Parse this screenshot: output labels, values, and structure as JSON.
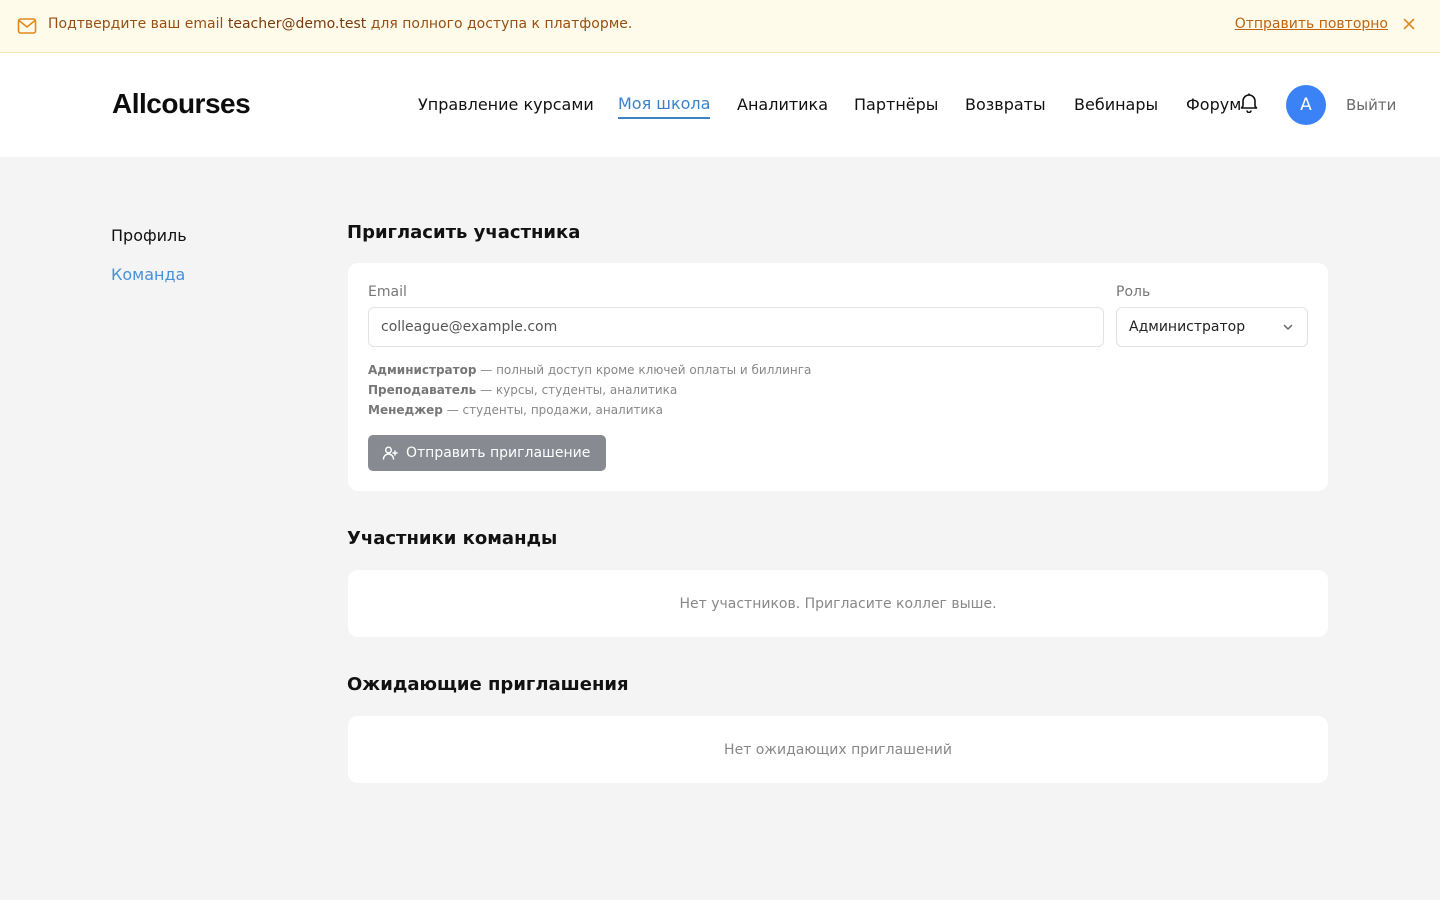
{
  "banner": {
    "message_prefix": "Подтвердите ваш email",
    "email": "teacher@demo.test",
    "message_suffix": "для полного доступа к платформе.",
    "resend_label": "Отправить повторно"
  },
  "header": {
    "logo": "Allcourses",
    "nav": [
      {
        "label": "Управление курсами",
        "active": false
      },
      {
        "label": "Моя школа",
        "active": true
      },
      {
        "label": "Аналитика",
        "active": false
      },
      {
        "label": "Партнёры",
        "active": false
      },
      {
        "label": "Возвраты",
        "active": false
      },
      {
        "label": "Вебинары",
        "active": false
      },
      {
        "label": "Форум",
        "active": false
      }
    ],
    "avatar_letter": "A",
    "logout_label": "Выйти"
  },
  "sidebar": {
    "items": [
      {
        "label": "Профиль",
        "active": false
      },
      {
        "label": "Команда",
        "active": true
      }
    ]
  },
  "invite": {
    "title": "Пригласить участника",
    "email_label": "Email",
    "email_placeholder": "colleague@example.com",
    "role_label": "Роль",
    "role_value": "Администратор",
    "roles": [
      {
        "name": "Администратор",
        "desc": " — полный доступ кроме ключей оплаты и биллинга"
      },
      {
        "name": "Преподаватель",
        "desc": " — курсы, студенты, аналитика"
      },
      {
        "name": "Менеджер",
        "desc": " — студенты, продажи, аналитика"
      }
    ],
    "send_label": "Отправить приглашение"
  },
  "members": {
    "title": "Участники команды",
    "empty": "Нет участников. Пригласите коллег выше."
  },
  "pending": {
    "title": "Ожидающие приглашения",
    "empty": "Нет ожидающих приглашений"
  },
  "colors": {
    "accent": "#3b82c7",
    "avatar": "#3b82f6",
    "banner_bg": "#fffbea",
    "banner_text": "#9a4f12",
    "button_bg": "#878b91"
  },
  "icons": {
    "banner": "mail-icon",
    "close": "close-icon",
    "notifications": "bell-icon",
    "select": "chevron-down-icon",
    "send": "user-plus-icon"
  }
}
